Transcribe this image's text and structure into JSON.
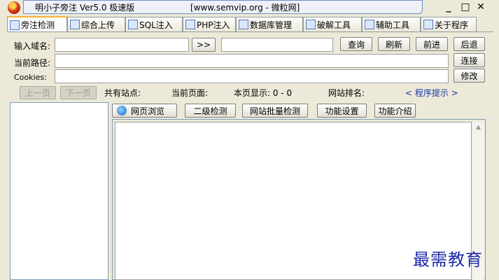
{
  "title_bar": {
    "app_title": "明小子旁注 Ver5.0 极速版",
    "site_title": "[www.semvip.org - 微粒网]",
    "minimize": "_",
    "maximize": "□",
    "close": "✕"
  },
  "tabs": [
    {
      "label": "旁注检测",
      "icon": "radar-icon"
    },
    {
      "label": "综合上传",
      "icon": "upload-icon"
    },
    {
      "label": "SQL注入",
      "icon": "magnifier-icon"
    },
    {
      "label": "PHP注入",
      "icon": "php-file-icon"
    },
    {
      "label": "数据库管理",
      "icon": "database-icon"
    },
    {
      "label": "破解工具",
      "icon": "crack-tool-icon"
    },
    {
      "label": "辅助工具",
      "icon": "helper-tool-icon"
    },
    {
      "label": "关于程序",
      "icon": "book-icon"
    }
  ],
  "form": {
    "domain_label": "输入域名:",
    "domain_value": "",
    "arrow_button": ">>",
    "ip_value": "",
    "query": "查询",
    "refresh": "刷新",
    "forward": "前进",
    "back": "后退",
    "path_label": "当前路径:",
    "path_value": "",
    "connect": "连接",
    "cookies_label": "Cookies:",
    "cookies_value": "",
    "modify": "修改"
  },
  "pager": {
    "prev": "上一页",
    "next": "下一页",
    "total_sites": "共有站点:",
    "current_page": "当前页面:",
    "page_display": "本页显示: 0 - 0",
    "site_rank": "网站排名:",
    "hint": "< 程序提示 >"
  },
  "subtabs": {
    "web_browse": "网页浏览",
    "second_level": "二级检测",
    "batch_check": "网站批量检测",
    "settings": "功能设置",
    "intro": "功能介绍"
  },
  "watermark": "最需教育"
}
